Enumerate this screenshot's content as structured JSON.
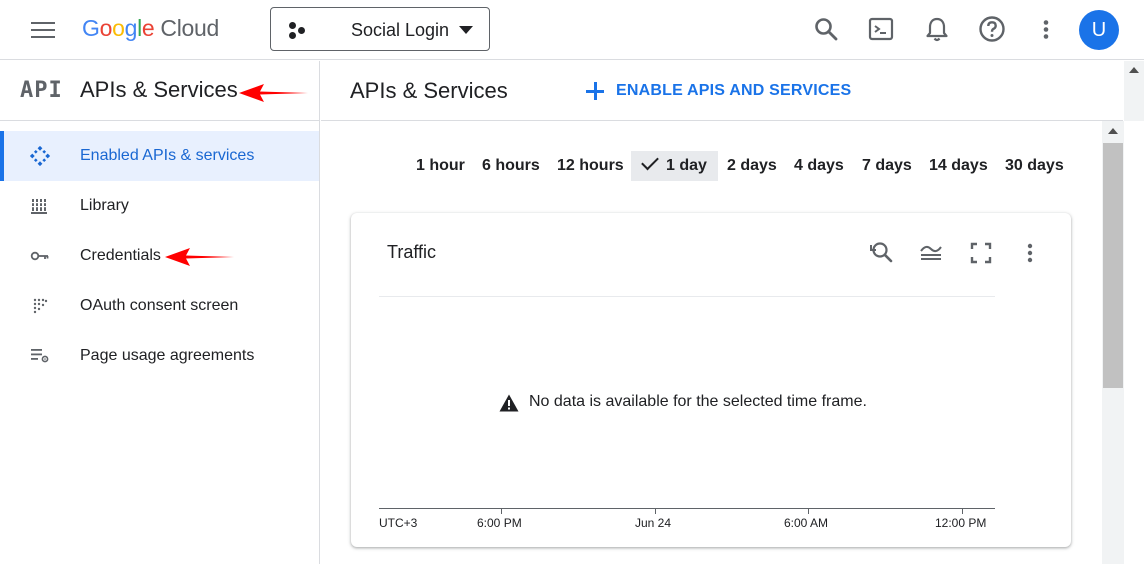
{
  "topbar": {
    "logo": {
      "google_letters": [
        "G",
        "o",
        "o",
        "g",
        "l",
        "e"
      ],
      "cloud": "Cloud"
    },
    "project_name": "Social Login",
    "avatar_initial": "U",
    "icons": [
      "menu-icon",
      "search-icon",
      "cloud-shell-icon",
      "notifications-icon",
      "help-icon",
      "more-vert-icon"
    ]
  },
  "sidebar": {
    "api_mark": "API",
    "title": "APIs & Services",
    "items": [
      {
        "label": "Enabled APIs & services",
        "icon": "enabled-apis-icon",
        "active": true
      },
      {
        "label": "Library",
        "icon": "library-icon",
        "active": false
      },
      {
        "label": "Credentials",
        "icon": "key-icon",
        "active": false
      },
      {
        "label": "OAuth consent screen",
        "icon": "oauth-consent-icon",
        "active": false
      },
      {
        "label": "Page usage agreements",
        "icon": "page-usage-icon",
        "active": false
      }
    ]
  },
  "main": {
    "title": "APIs & Services",
    "enable_button": "ENABLE APIS AND SERVICES",
    "time_range": {
      "options": [
        "1 hour",
        "6 hours",
        "12 hours",
        "1 day",
        "2 days",
        "4 days",
        "7 days",
        "14 days",
        "30 days"
      ],
      "selected": "1 day"
    },
    "traffic_card": {
      "title": "Traffic",
      "empty_message": "No data is available for the selected time frame.",
      "axis_labels": [
        "UTC+3",
        "6:00 PM",
        "Jun 24",
        "6:00 AM",
        "12:00 PM"
      ]
    }
  },
  "colors": {
    "accent": "#1a73e8",
    "active_bg": "#e8f0fe",
    "annotation_arrow": "#ff0000"
  }
}
